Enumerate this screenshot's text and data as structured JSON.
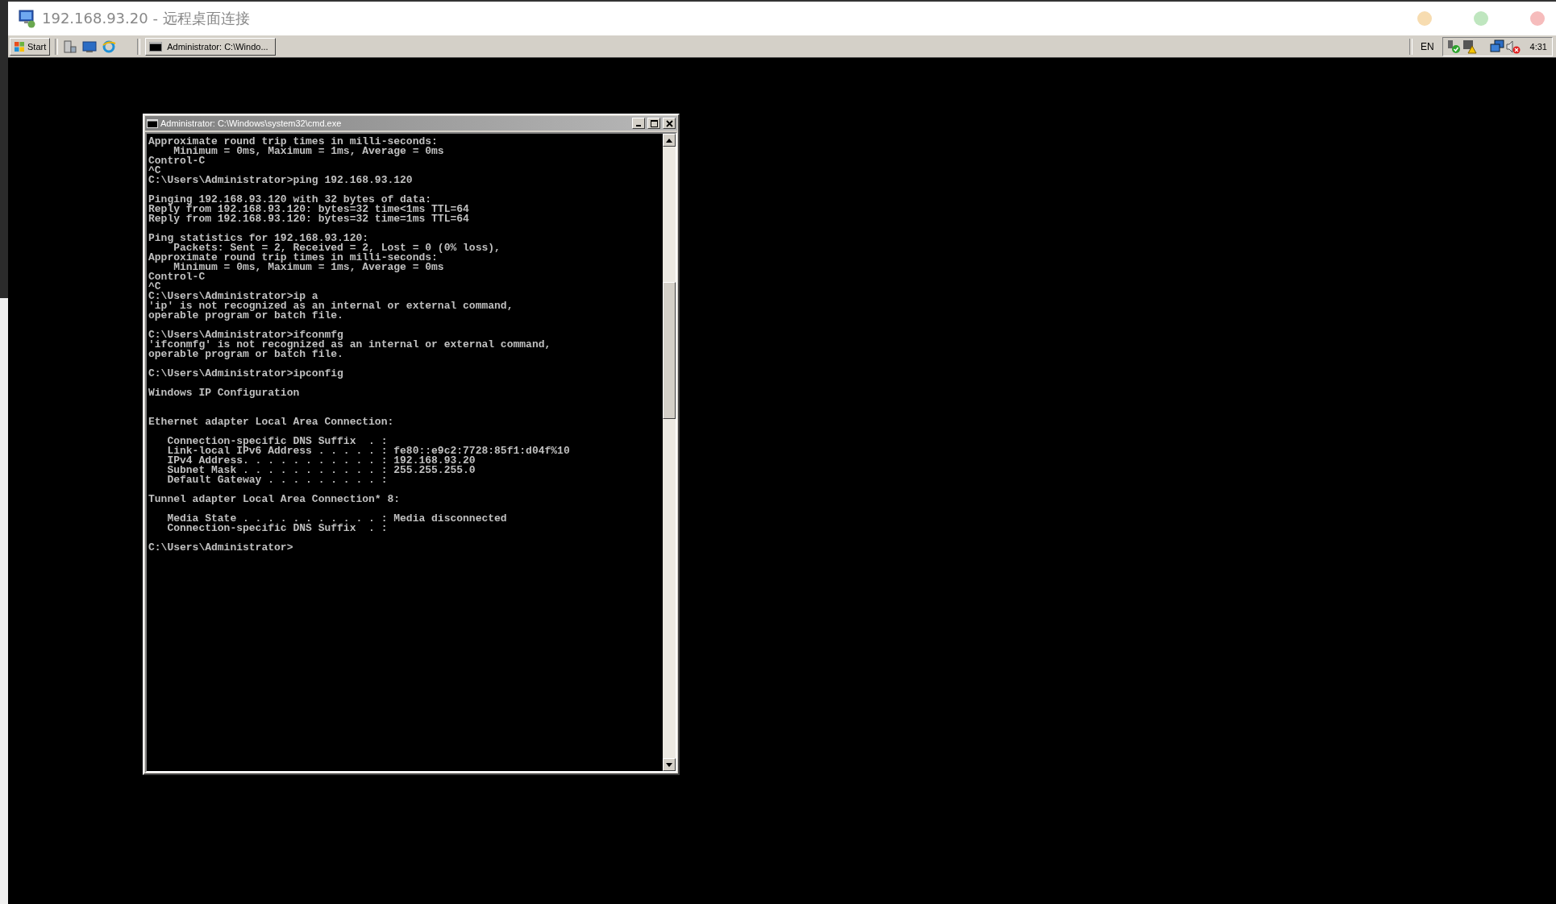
{
  "window": {
    "title": "192.168.93.20 - 远程桌面连接"
  },
  "taskbar": {
    "start_label": "Start",
    "tasks": [
      {
        "label": "Administrator: C:\\Windo...",
        "selected": false
      }
    ],
    "language": "EN",
    "clock": "4:31"
  },
  "console": {
    "title": "Administrator: C:\\Windows\\system32\\cmd.exe",
    "text": "Approximate round trip times in milli-seconds:\n    Minimum = 0ms, Maximum = 1ms, Average = 0ms\nControl-C\n^C\nC:\\Users\\Administrator>ping 192.168.93.120\n\nPinging 192.168.93.120 with 32 bytes of data:\nReply from 192.168.93.120: bytes=32 time<1ms TTL=64\nReply from 192.168.93.120: bytes=32 time=1ms TTL=64\n\nPing statistics for 192.168.93.120:\n    Packets: Sent = 2, Received = 2, Lost = 0 (0% loss),\nApproximate round trip times in milli-seconds:\n    Minimum = 0ms, Maximum = 1ms, Average = 0ms\nControl-C\n^C\nC:\\Users\\Administrator>ip a\n'ip' is not recognized as an internal or external command,\noperable program or batch file.\n\nC:\\Users\\Administrator>ifconmfg\n'ifconmfg' is not recognized as an internal or external command,\noperable program or batch file.\n\nC:\\Users\\Administrator>ipconfig\n\nWindows IP Configuration\n\n\nEthernet adapter Local Area Connection:\n\n   Connection-specific DNS Suffix  . :\n   Link-local IPv6 Address . . . . . : fe80::e9c2:7728:85f1:d04f%10\n   IPv4 Address. . . . . . . . . . . : 192.168.93.20\n   Subnet Mask . . . . . . . . . . . : 255.255.255.0\n   Default Gateway . . . . . . . . . :\n\nTunnel adapter Local Area Connection* 8:\n\n   Media State . . . . . . . . . . . : Media disconnected\n   Connection-specific DNS Suffix  . :\n\nC:\\Users\\Administrator>"
  }
}
